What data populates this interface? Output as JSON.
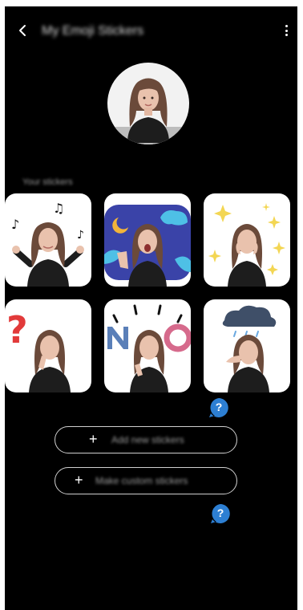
{
  "header": {
    "title": "My Emoji Stickers",
    "back_icon": "chevron-left-icon",
    "more_icon": "more-vertical-icon"
  },
  "profile": {
    "avatar_icon": "avatar-icon"
  },
  "stickers_section": {
    "label": "Your stickers",
    "items": [
      {
        "name": "sticker-dancing-music-notes"
      },
      {
        "name": "sticker-yawning-night"
      },
      {
        "name": "sticker-sparkles"
      },
      {
        "name": "sticker-question-mark"
      },
      {
        "name": "sticker-no"
      },
      {
        "name": "sticker-rain-cloud"
      }
    ]
  },
  "buttons": {
    "add_new": "Add new stickers",
    "make_custom": "Make custom stickers"
  },
  "help": {
    "symbol": "?"
  },
  "colors": {
    "background": "#000000",
    "help_badge": "#2d7fd3",
    "pill_border": "#cfcfcf"
  }
}
